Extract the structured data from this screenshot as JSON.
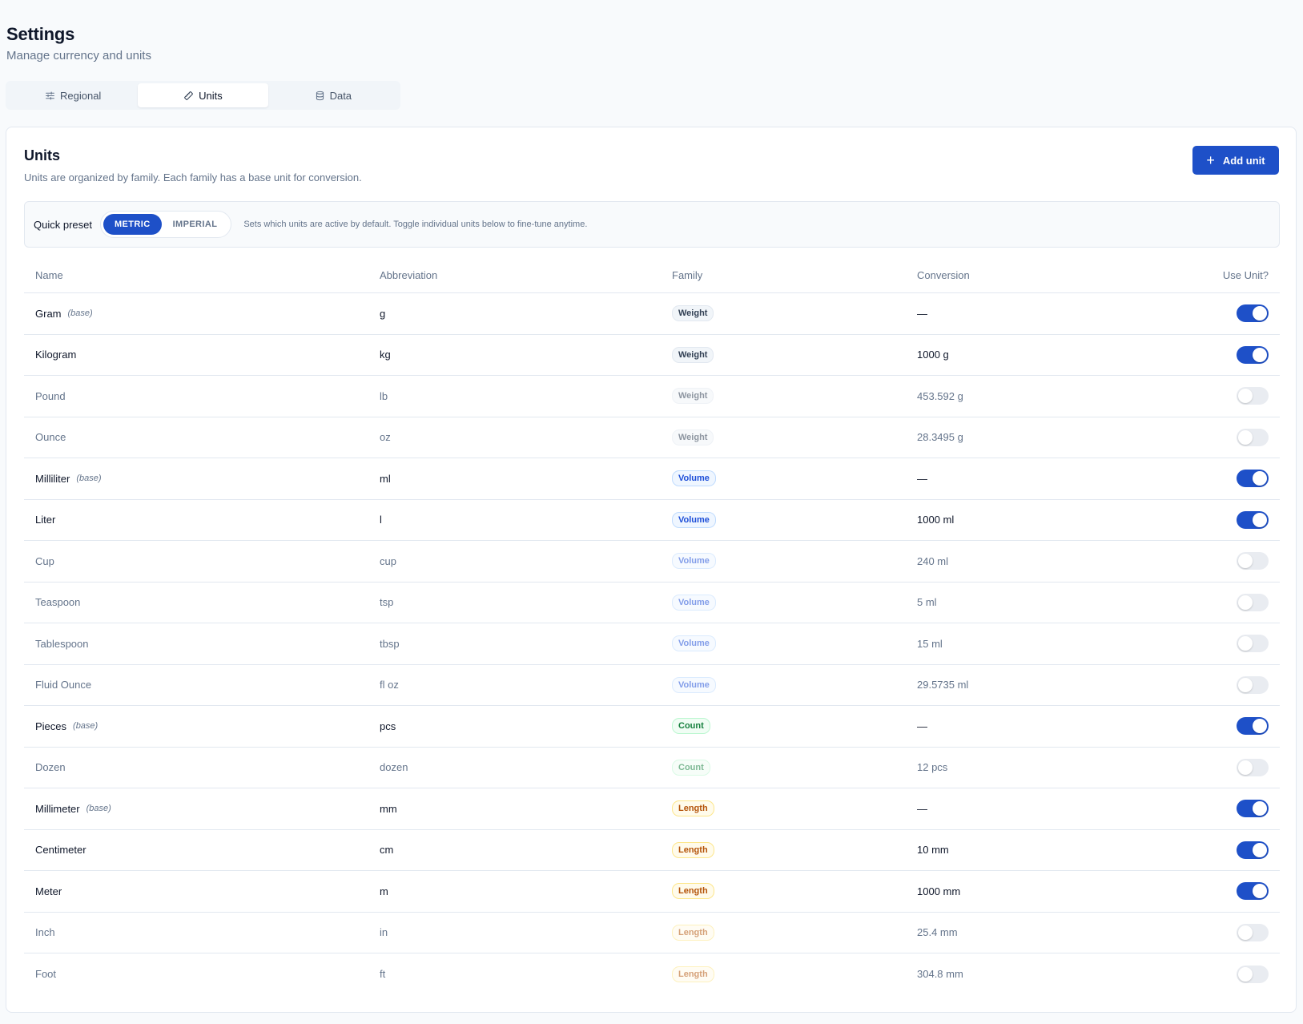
{
  "header": {
    "title": "Settings",
    "subtitle": "Manage currency and units"
  },
  "tabs": [
    {
      "label": "Regional",
      "icon": "sliders-icon",
      "active": false
    },
    {
      "label": "Units",
      "icon": "ruler-icon",
      "active": true
    },
    {
      "label": "Data",
      "icon": "database-icon",
      "active": false
    }
  ],
  "card": {
    "title": "Units",
    "description": "Units are organized by family. Each family has a base unit for conversion.",
    "add_button": "Add unit"
  },
  "preset": {
    "label": "Quick preset",
    "options": [
      {
        "label": "METRIC",
        "active": true
      },
      {
        "label": "IMPERIAL",
        "active": false
      }
    ],
    "hint": "Sets which units are active by default. Toggle individual units below to fine-tune anytime."
  },
  "table": {
    "columns": {
      "name": "Name",
      "abbreviation": "Abbreviation",
      "family": "Family",
      "conversion": "Conversion",
      "use": "Use Unit?"
    },
    "base_label": "(base)",
    "rows": [
      {
        "name": "Gram",
        "base": true,
        "abbr": "g",
        "family": "Weight",
        "conversion": "—",
        "enabled": true
      },
      {
        "name": "Kilogram",
        "base": false,
        "abbr": "kg",
        "family": "Weight",
        "conversion": "1000 g",
        "enabled": true
      },
      {
        "name": "Pound",
        "base": false,
        "abbr": "lb",
        "family": "Weight",
        "conversion": "453.592 g",
        "enabled": false
      },
      {
        "name": "Ounce",
        "base": false,
        "abbr": "oz",
        "family": "Weight",
        "conversion": "28.3495 g",
        "enabled": false
      },
      {
        "name": "Milliliter",
        "base": true,
        "abbr": "ml",
        "family": "Volume",
        "conversion": "—",
        "enabled": true
      },
      {
        "name": "Liter",
        "base": false,
        "abbr": "l",
        "family": "Volume",
        "conversion": "1000 ml",
        "enabled": true
      },
      {
        "name": "Cup",
        "base": false,
        "abbr": "cup",
        "family": "Volume",
        "conversion": "240 ml",
        "enabled": false
      },
      {
        "name": "Teaspoon",
        "base": false,
        "abbr": "tsp",
        "family": "Volume",
        "conversion": "5 ml",
        "enabled": false
      },
      {
        "name": "Tablespoon",
        "base": false,
        "abbr": "tbsp",
        "family": "Volume",
        "conversion": "15 ml",
        "enabled": false
      },
      {
        "name": "Fluid Ounce",
        "base": false,
        "abbr": "fl oz",
        "family": "Volume",
        "conversion": "29.5735 ml",
        "enabled": false
      },
      {
        "name": "Pieces",
        "base": true,
        "abbr": "pcs",
        "family": "Count",
        "conversion": "—",
        "enabled": true
      },
      {
        "name": "Dozen",
        "base": false,
        "abbr": "dozen",
        "family": "Count",
        "conversion": "12 pcs",
        "enabled": false
      },
      {
        "name": "Millimeter",
        "base": true,
        "abbr": "mm",
        "family": "Length",
        "conversion": "—",
        "enabled": true
      },
      {
        "name": "Centimeter",
        "base": false,
        "abbr": "cm",
        "family": "Length",
        "conversion": "10 mm",
        "enabled": true
      },
      {
        "name": "Meter",
        "base": false,
        "abbr": "m",
        "family": "Length",
        "conversion": "1000 mm",
        "enabled": true
      },
      {
        "name": "Inch",
        "base": false,
        "abbr": "in",
        "family": "Length",
        "conversion": "25.4 mm",
        "enabled": false
      },
      {
        "name": "Foot",
        "base": false,
        "abbr": "ft",
        "family": "Length",
        "conversion": "304.8 mm",
        "enabled": false
      }
    ]
  },
  "colors": {
    "accent": "#1e50c8",
    "family": {
      "Weight": {
        "bg": "#f1f5f9",
        "border": "#e2e8f0",
        "text": "#334155"
      },
      "Volume": {
        "bg": "#eff6ff",
        "border": "#bfdbfe",
        "text": "#1d4ed8"
      },
      "Count": {
        "bg": "#f0fdf4",
        "border": "#bbf7d0",
        "text": "#15803d"
      },
      "Length": {
        "bg": "#fffbeb",
        "border": "#fde68a",
        "text": "#b45309"
      }
    }
  }
}
